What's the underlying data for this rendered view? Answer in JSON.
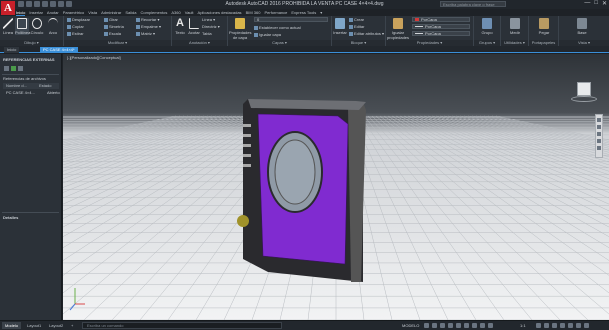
{
  "window": {
    "title": "Autodesk AutoCAD 2016   PROHIBIDA LA VENTA   PC CASE 4×4×4.dwg",
    "search_placeholder": "Escriba palabra clave o frase",
    "logo_letter": "A",
    "controls": [
      "—",
      "□",
      "✕"
    ]
  },
  "tabs": [
    "Inicio",
    "Insertar",
    "Anotar",
    "Paramétrico",
    "Vista",
    "Administrar",
    "Salida",
    "Complementos",
    "A360",
    "Vault",
    "Aplicaciones destacadas",
    "BIM 360",
    "Performance",
    "Express Tools",
    "▾"
  ],
  "active_tab": "Inicio",
  "ribbon": {
    "draw_panel": {
      "label": "Dibujo ▾",
      "buttons": [
        "Línea",
        "Polilínea",
        "Círculo",
        "Arco"
      ]
    },
    "modify_panel": {
      "label": "Modificar ▾",
      "rows": [
        [
          "Desplazar",
          "Girar",
          "Recortar ▾"
        ],
        [
          "Copiar",
          "Simetría",
          "Empalme ▾"
        ],
        [
          "Estirar",
          "Escala",
          "Matriz ▾"
        ]
      ]
    },
    "annotation_panel": {
      "label": "Anotación ▾",
      "buttons": [
        "Texto",
        "Acotar"
      ],
      "rows": [
        "Línea ▾",
        "Directriz ▾",
        "Tabla"
      ]
    },
    "layers_panel": {
      "label": "Capas ▾",
      "big_button": "Propiedades de capa",
      "dropdown": "0",
      "rows": [
        "Establecer como actual",
        "Igualar capa"
      ]
    },
    "block_panel": {
      "label": "Bloque ▾",
      "big_button": "Insertar",
      "rows": [
        "Crear",
        "Editar",
        "Editar atributos ▾"
      ]
    },
    "properties_panel": {
      "label": "Propiedades ▾",
      "big_button": "Igualar propiedades",
      "dropdowns": [
        "PorCapa",
        "PorCapa",
        "PorCapa"
      ]
    },
    "groups_panel": {
      "label": "Grupos ▾",
      "big_button": "Grupo"
    },
    "utilities_panel": {
      "label": "Utilidades ▾",
      "big_button": "Medir"
    },
    "clipboard_panel": {
      "label": "Portapapeles",
      "big_button": "Pegar"
    },
    "view_panel": {
      "label": "Vista ▾",
      "big_button": "Base"
    }
  },
  "doc_tabs": [
    "Inicio",
    "PC CASE 4×4×4*"
  ],
  "active_doc_tab": "PC CASE 4×4×4*",
  "palette": {
    "title": "REFERENCIAS EXTERNAS",
    "section": "Referencias de archivos",
    "columns": [
      "Nombre d...",
      "Estado"
    ],
    "rows": [
      [
        "PC CASE 4×4...",
        "Abierto"
      ]
    ],
    "details_title": "Detalles"
  },
  "viewport_label": "[-][Personalizado][Conceptual]",
  "layout_tabs": [
    "Modelo",
    "Layout1",
    "Layout2",
    "+"
  ],
  "active_layout_tab": "Modelo",
  "command_placeholder": "Escriba un comando",
  "status": {
    "mode": "MODELO",
    "scale": "1:1"
  },
  "colors": {
    "accent": "#3a8fd8",
    "model_fill": "#8a2be2",
    "brand": "#c8202a"
  }
}
